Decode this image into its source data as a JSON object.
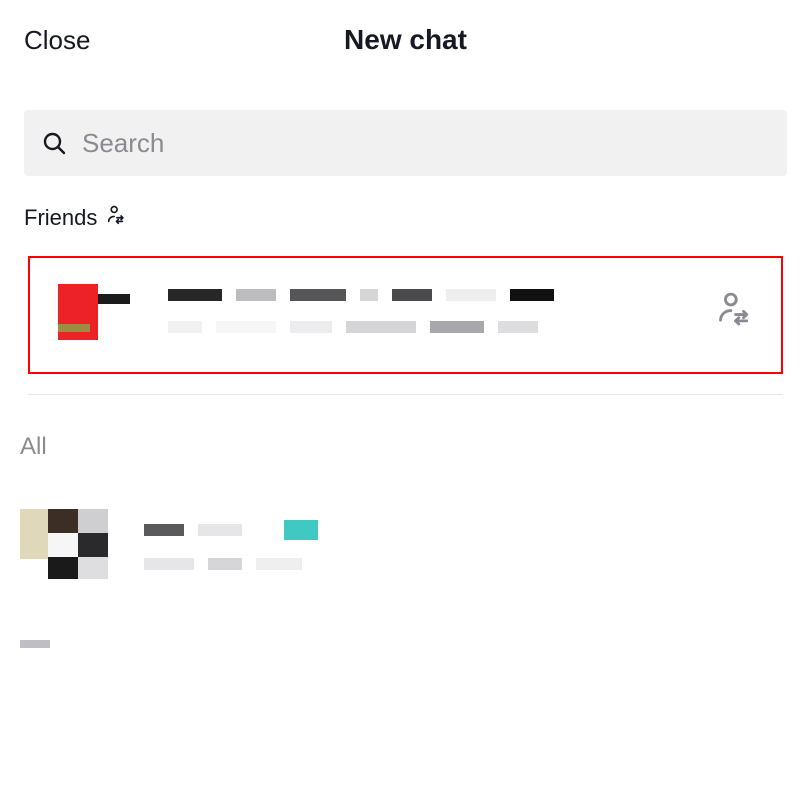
{
  "header": {
    "close_label": "Close",
    "title": "New chat"
  },
  "search": {
    "placeholder": "Search",
    "value": ""
  },
  "sections": {
    "friends_label": "Friends",
    "all_label": "All"
  },
  "friends": [
    {
      "display_name_redacted": true,
      "subtitle_redacted": true,
      "highlighted": true
    }
  ],
  "all_contacts": [
    {
      "display_name_redacted": true,
      "subtitle_redacted": true
    }
  ],
  "colors": {
    "highlight_border": "#ff0000",
    "search_bg": "#f1f1f2",
    "placeholder": "#8a8b91",
    "avatar_red": "#ec2226",
    "avatar_olive": "#9b8e42",
    "avatar_teal": "#3fc9c1",
    "avatar_brown": "#3c2e24",
    "avatar_beige": "#e0d8ba"
  }
}
